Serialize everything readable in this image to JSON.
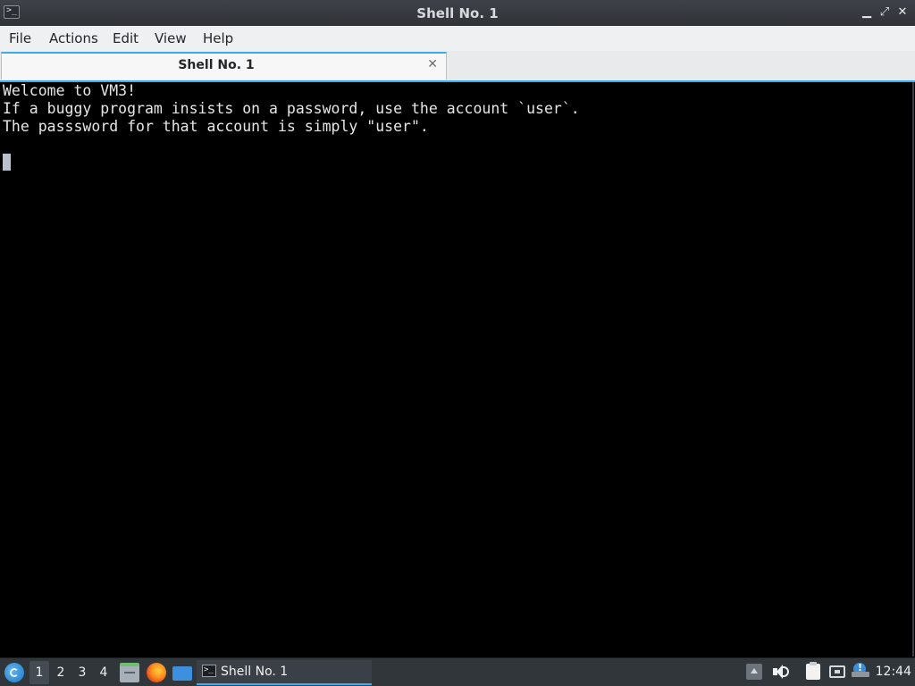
{
  "window": {
    "title": "Shell No. 1",
    "app_icon_glyph": ">_",
    "controls": {
      "minimize_glyph": "▁",
      "maximize_glyph": "⤢",
      "close_glyph": "✕"
    }
  },
  "menubar": {
    "items": [
      {
        "label": "File"
      },
      {
        "label": "Actions"
      },
      {
        "label": "Edit"
      },
      {
        "label": "View"
      },
      {
        "label": "Help"
      }
    ]
  },
  "tabs": [
    {
      "label": "Shell No. 1",
      "close_glyph": "✕",
      "active": true
    }
  ],
  "terminal": {
    "lines": [
      "Welcome to VM3!",
      "If a buggy program insists on a password, use the account `user`.",
      "The passsword for that account is simply \"user\"."
    ],
    "cursor_line": 4
  },
  "taskbar": {
    "start_icon": "lxqt-start-icon",
    "desktops": [
      "1",
      "2",
      "3",
      "4"
    ],
    "active_desktop": "1",
    "launchers": [
      "file-manager-icon",
      "firefox-icon",
      "show-desktop-icon"
    ],
    "window_button": {
      "icon_glyph": ">_",
      "label": "Shell No. 1"
    },
    "tray": [
      "tray-expand-icon",
      "volume-icon",
      "clipboard-icon",
      "network-icon",
      "update-notifier-icon"
    ],
    "clock": "12:44"
  },
  "colors": {
    "titlebar": "#31363b",
    "menubar": "#eff0f1",
    "accent": "#3daee9",
    "terminal_bg": "#000000",
    "terminal_fg": "#e6e6e6",
    "taskbar": "#31363b"
  }
}
